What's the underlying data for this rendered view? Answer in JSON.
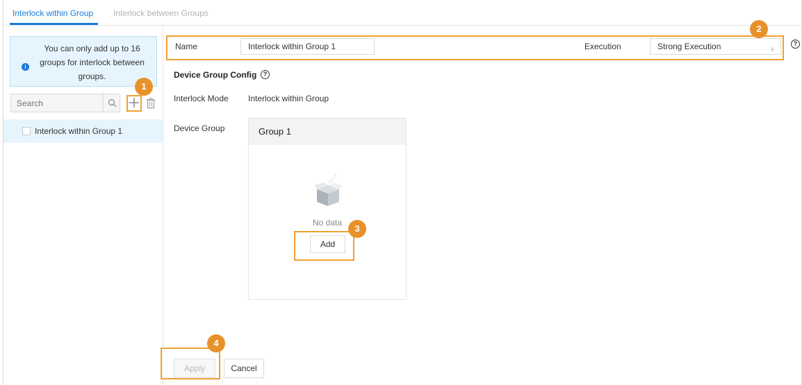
{
  "tabs": [
    {
      "label": "Interlock within Group",
      "active": true
    },
    {
      "label": "Interlock between Groups",
      "active": false
    }
  ],
  "sidebar": {
    "notice": "You can only add up to 16 groups for interlock between groups.",
    "search_placeholder": "Search",
    "items": [
      {
        "label": "Interlock within Group 1",
        "checked": false
      }
    ]
  },
  "form": {
    "name_label": "Name",
    "name_value": "Interlock within Group 1",
    "execution_label": "Execution",
    "execution_value": "Strong Execution",
    "section_title": "Device Group Config",
    "mode_label": "Interlock Mode",
    "mode_value": "Interlock within Group",
    "device_group_label": "Device Group",
    "group_title": "Group 1",
    "no_data": "No data",
    "add_label": "Add"
  },
  "footer": {
    "apply_label": "Apply",
    "cancel_label": "Cancel"
  },
  "markers": [
    "1",
    "2",
    "3",
    "4"
  ],
  "colors": {
    "accent": "#1a7bd6",
    "highlight": "#f0a030",
    "marker": "#e8912b",
    "notice_bg": "#e6f5fd"
  },
  "icons": [
    "info-icon",
    "search-icon",
    "plus-icon",
    "trash-icon",
    "help-icon",
    "chevron-down-icon",
    "empty-box-icon"
  ]
}
